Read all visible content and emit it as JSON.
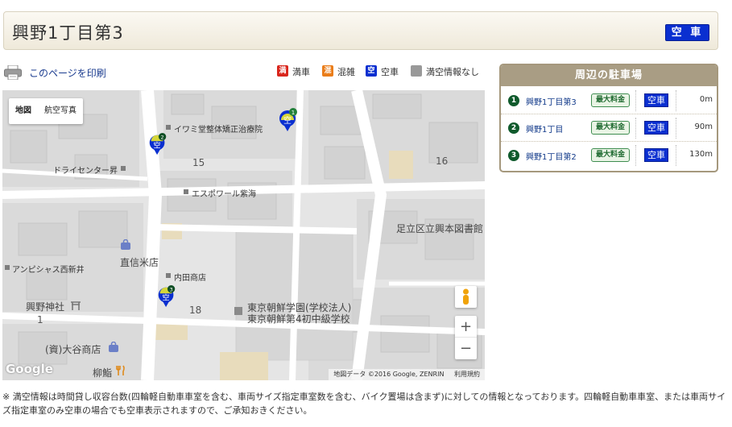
{
  "title": "興野1丁目第3",
  "title_status": "空 車",
  "print_link": "このページを印刷",
  "legend": [
    {
      "icon": "満",
      "label": "満車",
      "color": "#d9261c"
    },
    {
      "icon": "混",
      "label": "混雑",
      "color": "#ea7d1a"
    },
    {
      "icon": "空",
      "label": "空車",
      "color": "#0a2fd0"
    },
    {
      "icon": "",
      "label": "満空情報なし",
      "color": "#999999"
    }
  ],
  "map": {
    "type_buttons": [
      "地図",
      "航空写真"
    ],
    "labels": {
      "izumido": "イワミ堂整体矯正治療院",
      "dry": "ドライセンター昇",
      "esporeal": "エスポワール紫海",
      "library": "足立区立興本図書館",
      "anpisias": "アンピシャス西新井",
      "naoshin": "直信米店",
      "uchida": "内田商店",
      "gakuen1": "東京朝鮮学園(学校法人)",
      "gakuen2": "東京朝鮮第4初中級学校",
      "okino": "興野神社",
      "otani": "(資)大谷商店",
      "yanagi": "柳鮨",
      "n15": "15",
      "n16": "16",
      "n18": "18",
      "n1": "1"
    },
    "pins": [
      {
        "num": "1",
        "status": "空"
      },
      {
        "num": "2",
        "status": "空"
      },
      {
        "num": "3",
        "status": "空"
      }
    ],
    "zoom_in": "+",
    "zoom_out": "−",
    "logo": "Google",
    "attribution": "地図データ ©2016 Google, ZENRIN",
    "terms": "利用規約"
  },
  "sidebar": {
    "title": "周辺の駐車場",
    "rows": [
      {
        "num": "1",
        "name": "興野1丁目第3",
        "badge": "最大料金",
        "status": "空車",
        "distance": "0m"
      },
      {
        "num": "2",
        "name": "興野1丁目",
        "badge": "最大料金",
        "status": "空車",
        "distance": "90m"
      },
      {
        "num": "3",
        "name": "興野1丁目第2",
        "badge": "最大料金",
        "status": "空車",
        "distance": "130m"
      }
    ]
  },
  "note": "※ 満空情報は時間貸し収容台数(四輪軽自動車車室を含む、車両サイズ指定車室数を含む、バイク置場は含まず)に対しての情報となっております。四輪軽自動車車室、または車両サイズ指定車室のみ空車の場合でも空車表示されますので、ご承知おきください。"
}
